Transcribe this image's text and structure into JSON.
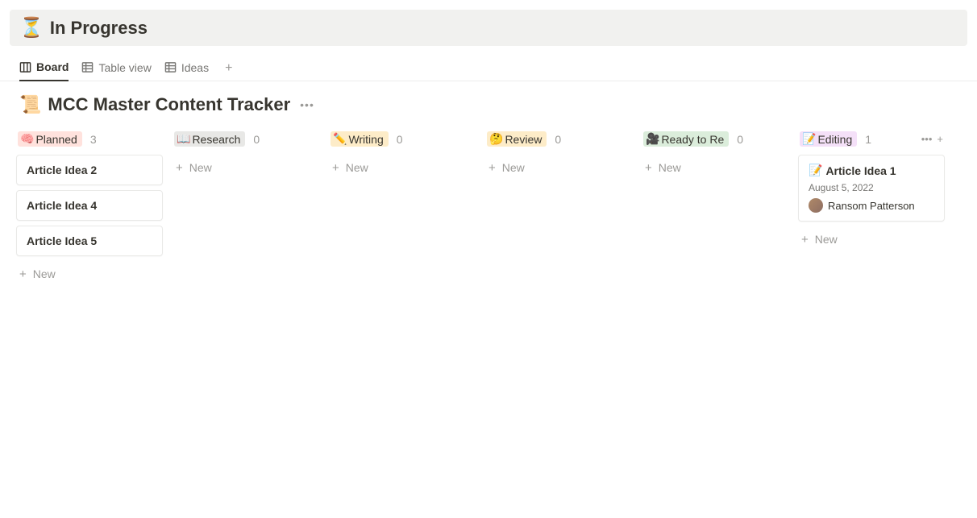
{
  "header": {
    "emoji": "⏳",
    "title": "In Progress"
  },
  "tabs": [
    {
      "icon": "board",
      "label": "Board",
      "active": true
    },
    {
      "icon": "table",
      "label": "Table view",
      "active": false
    },
    {
      "icon": "table",
      "label": "Ideas",
      "active": false
    }
  ],
  "database": {
    "emoji": "📜",
    "title": "MCC Master Content Tracker"
  },
  "new_label": "New",
  "columns": [
    {
      "status": {
        "emoji": "🧠",
        "label": "Planned",
        "bg": "#ffe2dd",
        "fg": "#37352f"
      },
      "count": 3,
      "cards": [
        {
          "title": "Article Idea 2"
        },
        {
          "title": "Article Idea 4"
        },
        {
          "title": "Article Idea 5"
        }
      ]
    },
    {
      "status": {
        "emoji": "📖",
        "label": "Research",
        "bg": "#e8e8e6",
        "fg": "#37352f"
      },
      "count": 0,
      "cards": []
    },
    {
      "status": {
        "emoji": "✏️",
        "label": "Writing",
        "bg": "#fdecc8",
        "fg": "#37352f"
      },
      "count": 0,
      "cards": []
    },
    {
      "status": {
        "emoji": "🤔",
        "label": "Review",
        "bg": "#fdecc8",
        "fg": "#37352f"
      },
      "count": 0,
      "cards": []
    },
    {
      "status": {
        "emoji": "🎥",
        "label": "Ready to Re",
        "bg": "#dbeddb",
        "fg": "#37352f"
      },
      "count": 0,
      "cards": []
    },
    {
      "status": {
        "emoji": "📝",
        "label": "Editing",
        "bg": "#f4e0f8",
        "fg": "#37352f"
      },
      "count": 1,
      "show_actions": true,
      "cards": [
        {
          "emoji": "📝",
          "title": "Article Idea 1",
          "date": "August 5, 2022",
          "person": "Ransom Patterson"
        }
      ]
    }
  ]
}
